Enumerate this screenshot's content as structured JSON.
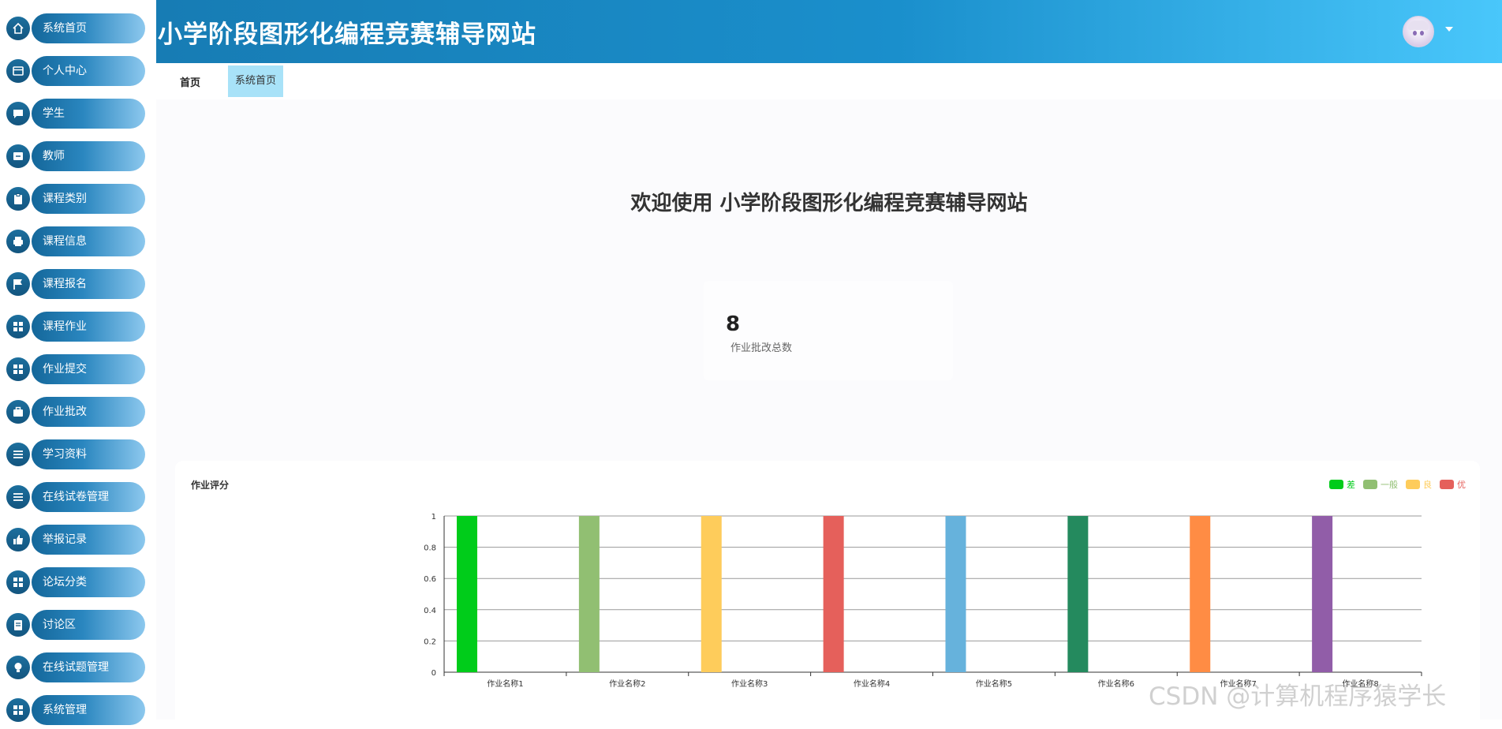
{
  "header": {
    "site_title": "小学阶段图形化编程竞赛辅导网站"
  },
  "sidebar": {
    "items": [
      {
        "label": "系统首页",
        "icon": "home-icon"
      },
      {
        "label": "个人中心",
        "icon": "window-icon"
      },
      {
        "label": "学生",
        "icon": "chat-icon"
      },
      {
        "label": "教师",
        "icon": "box-icon"
      },
      {
        "label": "课程类别",
        "icon": "clipboard-icon"
      },
      {
        "label": "课程信息",
        "icon": "printer-icon"
      },
      {
        "label": "课程报名",
        "icon": "flag-icon"
      },
      {
        "label": "课程作业",
        "icon": "grid-icon"
      },
      {
        "label": "作业提交",
        "icon": "grid-icon"
      },
      {
        "label": "作业批改",
        "icon": "briefcase-icon"
      },
      {
        "label": "学习资料",
        "icon": "list-icon"
      },
      {
        "label": "在线试卷管理",
        "icon": "list-icon"
      },
      {
        "label": "举报记录",
        "icon": "thumb-icon"
      },
      {
        "label": "论坛分类",
        "icon": "grid-icon"
      },
      {
        "label": "讨论区",
        "icon": "document-icon"
      },
      {
        "label": "在线试题管理",
        "icon": "bulb-icon"
      },
      {
        "label": "系统管理",
        "icon": "grid-icon"
      }
    ]
  },
  "tabs": {
    "home": "首页",
    "active": "系统首页"
  },
  "main": {
    "welcome": "欢迎使用 小学阶段图形化编程竞赛辅导网站",
    "stat_value": "8",
    "stat_label": "作业批改总数"
  },
  "chart_data": {
    "type": "bar",
    "title": "作业评分",
    "categories": [
      "作业名称1",
      "作业名称2",
      "作业名称3",
      "作业名称4",
      "作业名称5",
      "作业名称6",
      "作业名称7",
      "作业名称8"
    ],
    "values": [
      1,
      1,
      1,
      1,
      1,
      1,
      1,
      1
    ],
    "bar_colors": [
      "#00cc1a",
      "#91bf72",
      "#fecc5b",
      "#e5605b",
      "#66b2dc",
      "#248a5e",
      "#ff8c44",
      "#915da8"
    ],
    "ylim": [
      0,
      1
    ],
    "yticks": [
      "0",
      "0.2",
      "0.4",
      "0.6",
      "0.8",
      "1"
    ],
    "legend": [
      {
        "name": "差",
        "color": "#00cc1a"
      },
      {
        "name": "一般",
        "color": "#91bf72"
      },
      {
        "name": "良",
        "color": "#fecc5b"
      },
      {
        "name": "优",
        "color": "#e5605b"
      }
    ],
    "legend_position": "top-right",
    "grid": true
  },
  "watermark": "CSDN @计算机程序猿学长"
}
